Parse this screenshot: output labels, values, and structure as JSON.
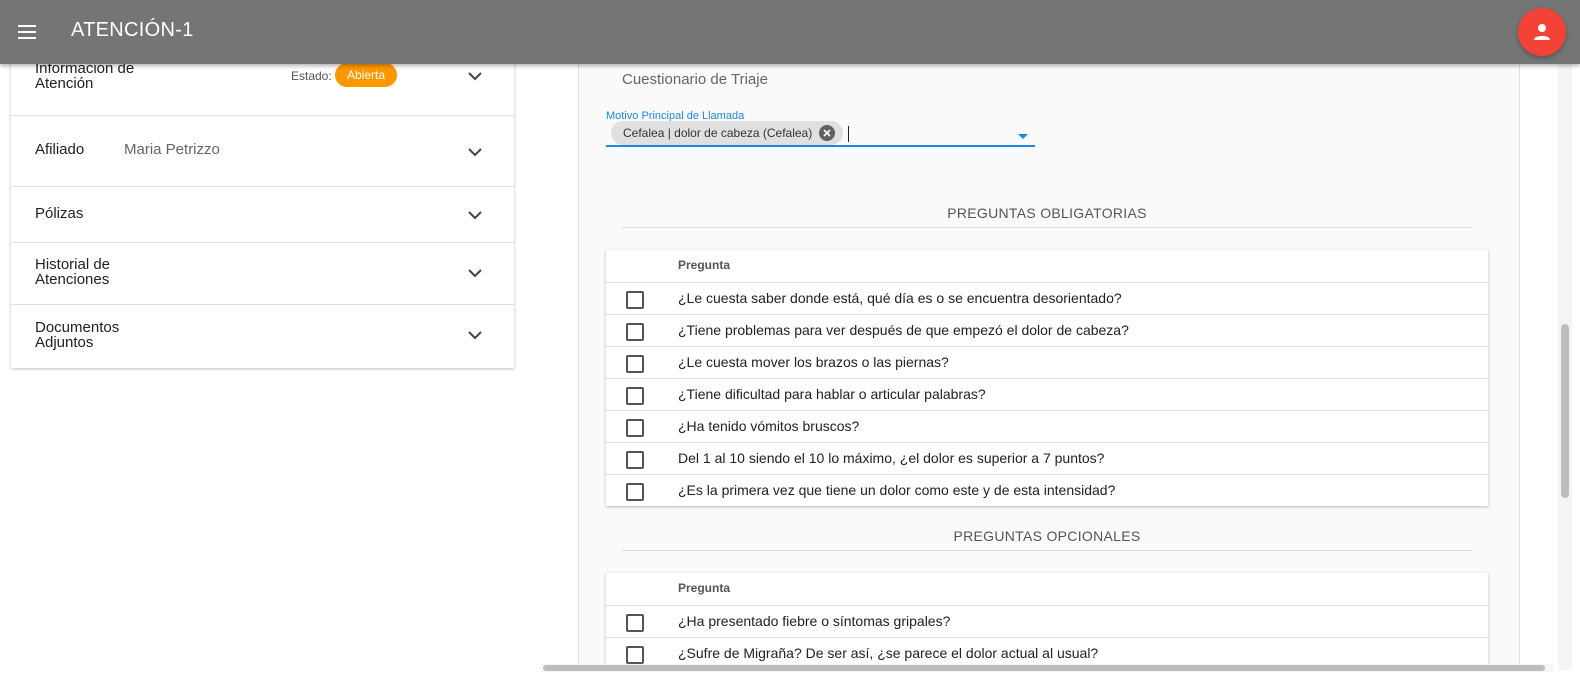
{
  "header": {
    "title": "ATENCIÓN-1",
    "menu_icon": "menu-icon",
    "avatar_icon": "person-icon",
    "avatar_color": "#f44336",
    "bar_color": "#757575"
  },
  "left_panel": {
    "sections": [
      {
        "title": "Información de Atención",
        "title_line1": "Información de",
        "title_line2": "Atención",
        "estado_label": "Estado:",
        "estado_value": "Abierta",
        "badge_color": "#ff9800"
      },
      {
        "title": "Afiliado",
        "value": "Maria Petrizzo"
      },
      {
        "title": "Pólizas"
      },
      {
        "title": "Historial de Atenciones",
        "title_line1": "Historial de",
        "title_line2": "Atenciones"
      },
      {
        "title": "Documentos Adjuntos",
        "title_line1": "Documentos",
        "title_line2": "Adjuntos"
      }
    ]
  },
  "main": {
    "section_title": "Cuestionario de Triaje",
    "motivo": {
      "label": "Motivo Principal de Llamada",
      "chip": "Cefalea | dolor de cabeza (Cefalea)",
      "accent": "#1e88e5"
    },
    "obligatorias": {
      "title": "PREGUNTAS OBLIGATORIAS",
      "column": "Pregunta",
      "rows": [
        "¿Le cuesta saber donde está, qué día es o se encuentra desorientado?",
        "¿Tiene problemas para ver después de que empezó el dolor de cabeza?",
        "¿Le cuesta mover los brazos o las piernas?",
        "¿Tiene dificultad para hablar o articular palabras?",
        "¿Ha tenido vómitos bruscos?",
        "Del 1 al 10 siendo el 10 lo máximo, ¿el dolor es superior a 7 puntos?",
        "¿Es la primera vez que tiene un dolor como este y de esta intensidad?"
      ]
    },
    "opcionales": {
      "title": "PREGUNTAS OPCIONALES",
      "column": "Pregunta",
      "rows": [
        "¿Ha presentado fiebre o síntomas gripales?",
        "¿Sufre de Migraña? De ser así, ¿se parece el dolor actual al usual?"
      ]
    }
  }
}
